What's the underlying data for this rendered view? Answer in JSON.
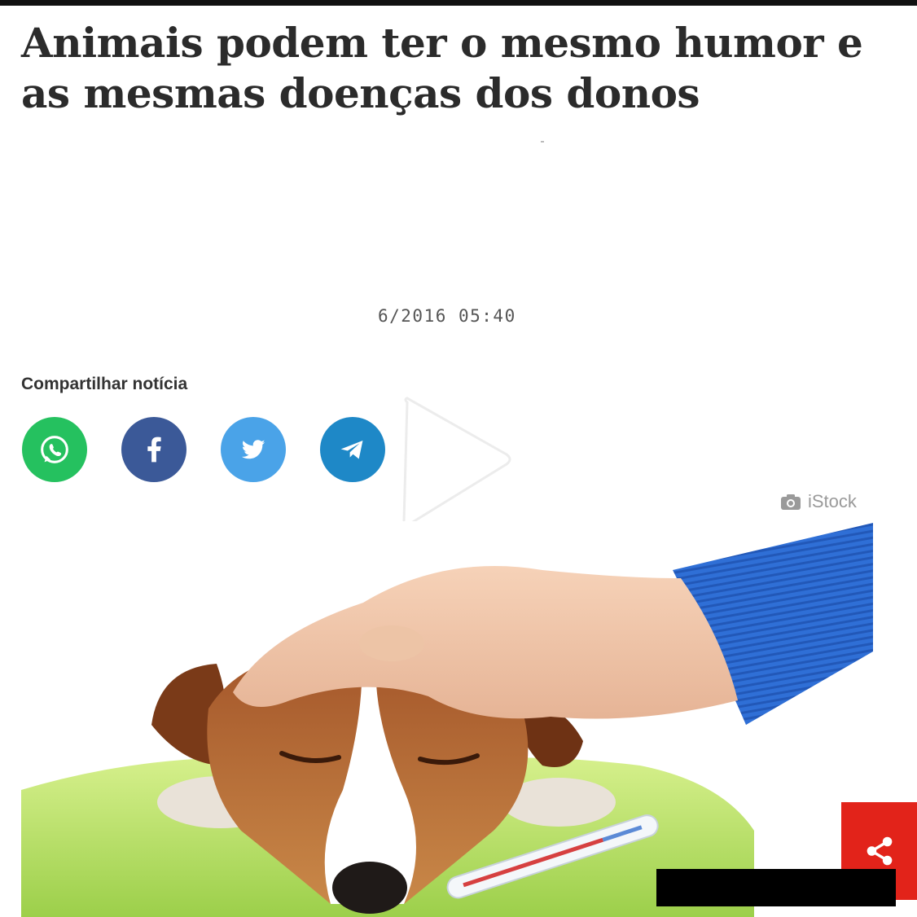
{
  "article": {
    "headline": "Animais podem ter o mesmo humor e as mesmas doenças dos donos",
    "timestamp": "6/2016 05:40"
  },
  "share": {
    "label": "Compartilhar notícia",
    "buttons": [
      {
        "network": "whatsapp",
        "icon": "whatsapp-icon",
        "color": "#25c15f"
      },
      {
        "network": "facebook",
        "icon": "facebook-icon",
        "color": "#3b5998"
      },
      {
        "network": "twitter",
        "icon": "twitter-icon",
        "color": "#4aa3e8"
      },
      {
        "network": "telegram",
        "icon": "telegram-icon",
        "color": "#1e88c7"
      }
    ]
  },
  "image": {
    "credit": "iStock",
    "credit_icon": "camera-icon",
    "description_icon": "play-icon"
  },
  "floating_share": {
    "icon": "share-icon",
    "color": "#e2231a"
  },
  "colors": {
    "headline": "#2b2b2b",
    "sweater": "#2f6fd6",
    "pillow": "#b9e36a"
  }
}
